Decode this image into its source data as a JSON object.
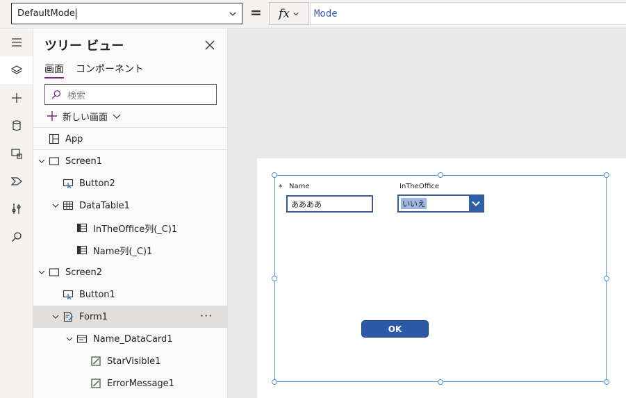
{
  "formula_bar": {
    "property": "DefaultMode",
    "equals": "=",
    "fx_label": "fx",
    "formula": "Mode"
  },
  "left_rail": {
    "items": [
      {
        "icon": "hamburger-icon"
      },
      {
        "icon": "layers-icon",
        "active": true
      },
      {
        "icon": "plus-icon"
      },
      {
        "icon": "database-icon"
      },
      {
        "icon": "media-icon"
      },
      {
        "icon": "power-automate-icon"
      },
      {
        "icon": "tools-icon"
      },
      {
        "icon": "search-icon"
      }
    ]
  },
  "tree": {
    "title": "ツリー ビュー",
    "tabs": {
      "screens": "画面",
      "components": "コンポーネント"
    },
    "search_placeholder": "検索",
    "new_screen": "新しい画面",
    "items": [
      {
        "label": "App",
        "icon": "app-icon"
      },
      {
        "label": "Screen1",
        "icon": "screen-icon"
      },
      {
        "label": "Button2",
        "icon": "button-icon"
      },
      {
        "label": "DataTable1",
        "icon": "table-icon"
      },
      {
        "label": "InTheOffice列(_C)1",
        "icon": "column-icon"
      },
      {
        "label": "Name列(_C)1",
        "icon": "column-icon"
      },
      {
        "label": "Screen2",
        "icon": "screen-icon"
      },
      {
        "label": "Button1",
        "icon": "button-icon"
      },
      {
        "label": "Form1",
        "icon": "form-icon",
        "more": "···"
      },
      {
        "label": "Name_DataCard1",
        "icon": "datacard-icon"
      },
      {
        "label": "StarVisible1",
        "icon": "edit-icon"
      },
      {
        "label": "ErrorMessage1",
        "icon": "edit-icon"
      }
    ]
  },
  "form": {
    "required": "*",
    "name_label": "Name",
    "name_value": "ああああ",
    "inoffice_label": "InTheOffice",
    "inoffice_value": "いいえ",
    "ok_label": "OK"
  },
  "colors": {
    "accent": "#742774",
    "selection": "#4a90d9",
    "button": "#2e59a8"
  }
}
